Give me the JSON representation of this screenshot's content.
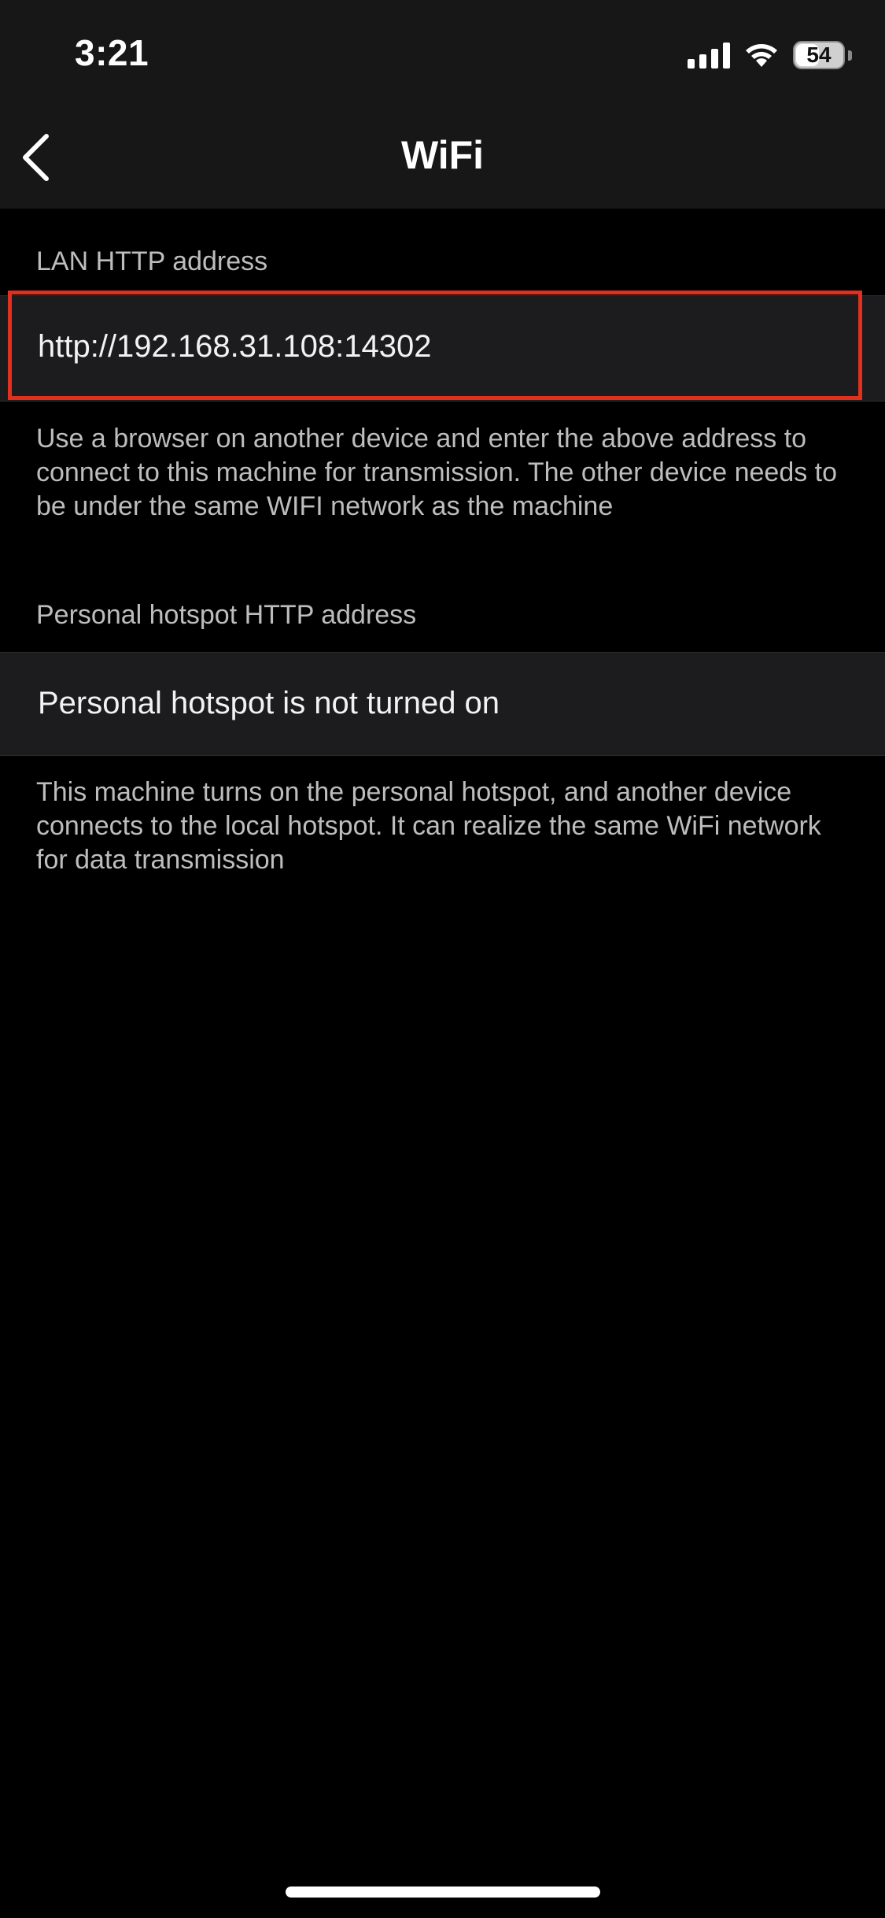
{
  "status_bar": {
    "time": "3:21",
    "battery_level": "54",
    "battery_fraction": 0.54,
    "icons": [
      "signal-icon",
      "wifi-icon",
      "battery-icon"
    ]
  },
  "nav": {
    "title": "WiFi",
    "back_icon": "chevron-left-icon"
  },
  "lan": {
    "header": "LAN HTTP address",
    "address": "http://192.168.31.108:14302",
    "description": "Use a browser on another device and enter the above address to connect to this machine for transmission. The other device needs to be under the same WIFI network as the machine"
  },
  "hotspot": {
    "header": "Personal hotspot HTTP address",
    "status": "Personal hotspot is not turned on",
    "description": "This machine turns on the personal hotspot, and another device connects to the local hotspot. It can realize the same WiFi network for data transmission"
  },
  "colors": {
    "background": "#000000",
    "bar_background": "#171717",
    "cell_background": "#1c1c1e",
    "secondary_text": "#bdbdbd",
    "highlight_border": "#e0301e"
  }
}
